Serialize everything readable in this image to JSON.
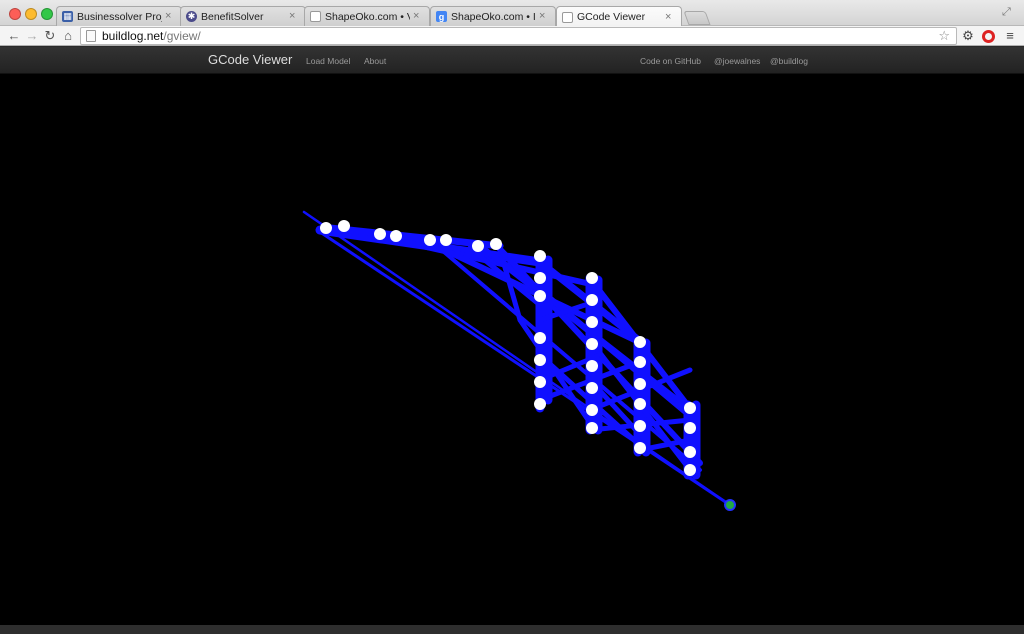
{
  "browser": {
    "tabs": [
      {
        "title": "Businessolver Project Man",
        "favicon": "grid-icon",
        "color": "#3a5fa8",
        "active": false
      },
      {
        "title": "BenefitSolver",
        "favicon": "benefitsolver-icon",
        "color": "#4a4a8a",
        "active": false
      },
      {
        "title": "ShapeOko.com • View topi",
        "favicon": "page-icon",
        "color": "#ffffff",
        "active": false
      },
      {
        "title": "ShapeOko.com • Index pa",
        "favicon": "google-icon",
        "color": "#4285f4",
        "active": false
      },
      {
        "title": "GCode Viewer",
        "favicon": "page-icon",
        "color": "#ffffff",
        "active": true
      }
    ],
    "url_domain": "buildlog.net",
    "url_path": "/gview/"
  },
  "app": {
    "brand": "GCode Viewer",
    "nav_left": [
      "Load Model",
      "About"
    ],
    "nav_right": [
      "Code on GitHub",
      "@joewalnes",
      "@buildlog"
    ]
  },
  "viewer": {
    "background": "#000000",
    "toolpath_color": "#1010ff",
    "marker_color": "#ffffff",
    "origin_color": "#22aa44"
  }
}
